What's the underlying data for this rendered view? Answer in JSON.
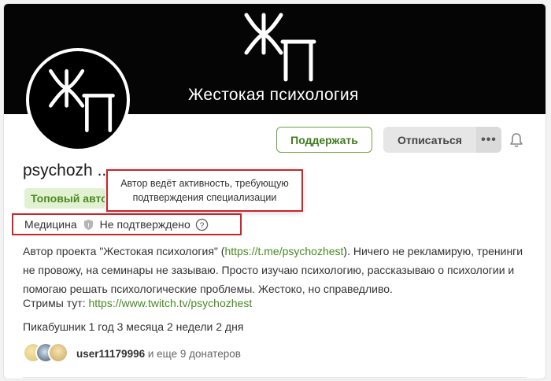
{
  "cover": {
    "logo_text": "ЖП",
    "title": "Жестокая психология"
  },
  "avatar": {
    "logo_text": "ЖП"
  },
  "actions": {
    "support_label": "Поддержать",
    "unsubscribe_label": "Отписаться",
    "more_label": "•••"
  },
  "profile": {
    "username": "psychozh",
    "username_tail": "...",
    "badge": "Топовый авто"
  },
  "tooltip": {
    "line1": "Автор ведёт активность, требующую",
    "line2": "подтверждения специализации"
  },
  "specialization": {
    "name": "Медицина",
    "status": "Не подтверждено",
    "help_label": "?"
  },
  "description": {
    "text_before": "Автор проекта \"Жестокая психология\" (",
    "link": "https://t.me/psychozhest",
    "text_after": "). Ничего не рекламирую, тренинги не провожу, на семинары не зазываю. Просто изучаю психологию, рассказываю о психологии и помогаю решать психологические проблемы. Жестоко, но справедливо."
  },
  "streams": {
    "label": "Стримы тут: ",
    "link": "https://www.twitch.tv/psychozhest"
  },
  "since": "Пикабушник 1 год 3 месяца 2 недели 2 дня",
  "donors": {
    "top_user": "user11179996",
    "rest": "и еще 9 донатеров"
  },
  "colors": {
    "accent_green": "#4a8a22",
    "highlight_red": "#c8262c"
  }
}
